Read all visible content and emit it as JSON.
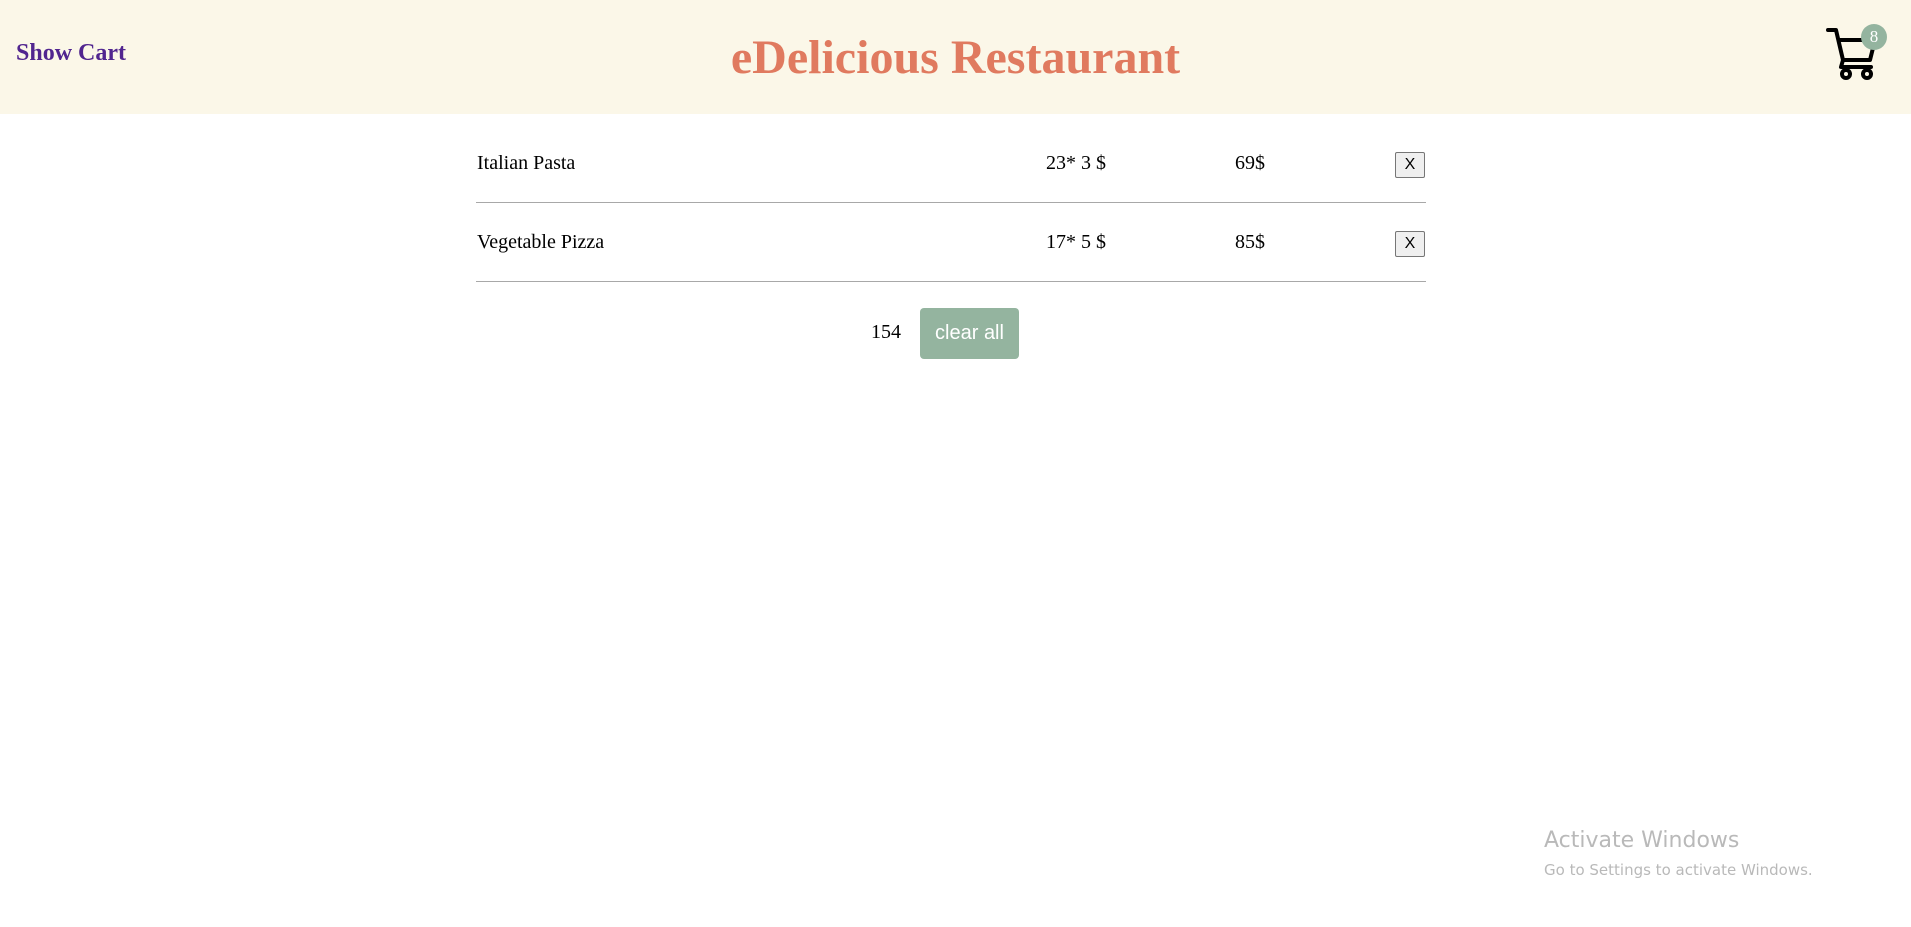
{
  "header": {
    "show_cart_label": "Show Cart",
    "title": "eDelicious Restaurant",
    "cart_icon": "shopping-cart-icon",
    "cart_count": "8"
  },
  "cart": {
    "items": [
      {
        "name": "Italian Pasta",
        "qty_price": "23* 3 $",
        "total": "69$",
        "remove_label": "X"
      },
      {
        "name": "Vegetable Pizza",
        "qty_price": "17* 5 $",
        "total": "85$",
        "remove_label": "X"
      }
    ],
    "grand_total": "154",
    "clear_label": "clear all"
  },
  "os_watermark": {
    "title": "Activate Windows",
    "subtitle": "Go to Settings to activate Windows."
  },
  "colors": {
    "header_bg": "#fbf7e8",
    "title": "#e07a5f",
    "show_cart": "#51258f",
    "accent_green": "#94b49f"
  }
}
